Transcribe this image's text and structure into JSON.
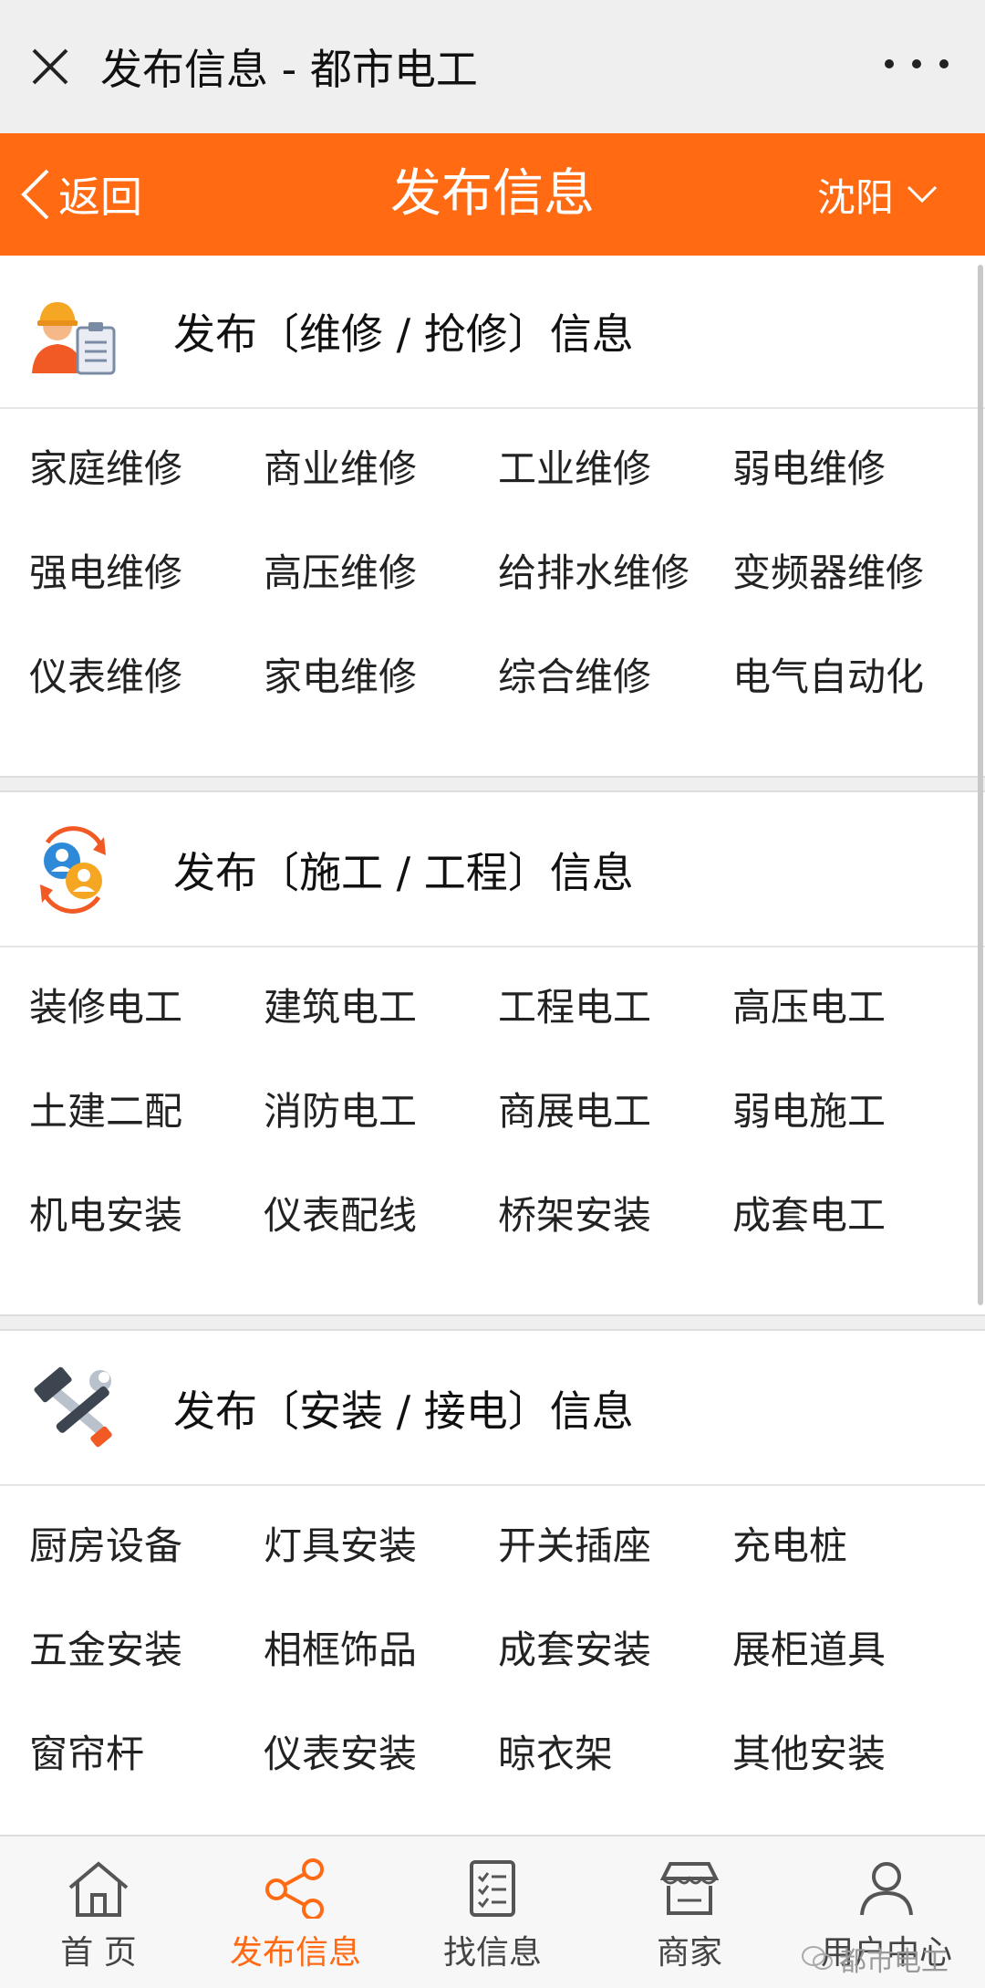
{
  "window": {
    "title": "发布信息 - 都市电工"
  },
  "header": {
    "back_label": "返回",
    "title": "发布信息",
    "city": "沈阳"
  },
  "sections": [
    {
      "title": "发布〔维修 / 抢修〕信息",
      "icon": "worker-icon",
      "items": [
        "家庭维修",
        "商业维修",
        "工业维修",
        "弱电维修",
        "强电维修",
        "高压维修",
        "给排水维修",
        "变频器维修",
        "仪表维修",
        "家电维修",
        "综合维修",
        "电气自动化"
      ]
    },
    {
      "title": "发布〔施工 / 工程〕信息",
      "icon": "people-exchange-icon",
      "items": [
        "装修电工",
        "建筑电工",
        "工程电工",
        "高压电工",
        "土建二配",
        "消防电工",
        "商展电工",
        "弱电施工",
        "机电安装",
        "仪表配线",
        "桥架安装",
        "成套电工"
      ]
    },
    {
      "title": "发布〔安装 / 接电〕信息",
      "icon": "hammer-wrench-icon",
      "items": [
        "厨房设备",
        "灯具安装",
        "开关插座",
        "充电桩",
        "五金安装",
        "相框饰品",
        "成套安装",
        "展柜道具",
        "窗帘杆",
        "仪表安装",
        "晾衣架",
        "其他安装"
      ]
    }
  ],
  "tabbar": {
    "items": [
      {
        "label": "首 页",
        "icon": "home-icon"
      },
      {
        "label": "发布信息",
        "icon": "share-icon",
        "active": true
      },
      {
        "label": "找信息",
        "icon": "document-list-icon"
      },
      {
        "label": "商家",
        "icon": "store-icon"
      },
      {
        "label": "用户中心",
        "icon": "user-icon"
      }
    ]
  },
  "watermark": "都市电工",
  "colors": {
    "accent": "#ff6a13",
    "background": "#efefef"
  }
}
